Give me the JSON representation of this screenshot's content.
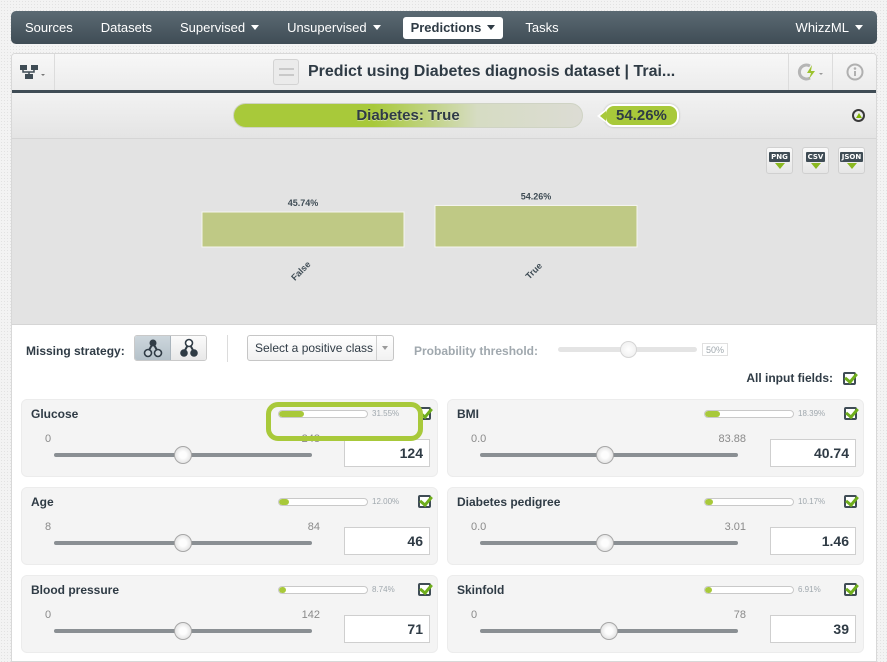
{
  "nav": {
    "items": [
      {
        "label": "Sources",
        "caret": false
      },
      {
        "label": "Datasets",
        "caret": false
      },
      {
        "label": "Supervised",
        "caret": true
      },
      {
        "label": "Unsupervised",
        "caret": true
      },
      {
        "label": "Predictions",
        "caret": true,
        "active": true
      },
      {
        "label": "Tasks",
        "caret": false
      }
    ],
    "right": {
      "label": "WhizzML"
    }
  },
  "toolbar": {
    "left_icon": "tree-structure-icon",
    "title": "Predict using Diabetes diagnosis dataset | Trai...",
    "title_icon": "model-sliders-icon",
    "right_icons": [
      "lightning-cycle-icon",
      "info-icon"
    ]
  },
  "prediction": {
    "label": "Diabetes: True",
    "confidence": "54.26%",
    "colors": {
      "accent": "#a8c93a",
      "dark": "#3f4c55"
    }
  },
  "exports": [
    {
      "label": "PNG"
    },
    {
      "label": "CSV"
    },
    {
      "label": "JSON"
    }
  ],
  "chart_data": {
    "type": "bar",
    "categories": [
      "False",
      "True"
    ],
    "values": [
      45.74,
      54.26
    ],
    "value_labels": [
      "45.74%",
      "54.26%"
    ],
    "title": "",
    "xlabel": "",
    "ylabel": "",
    "ylim": [
      0,
      100
    ],
    "grid": false,
    "bar_color": "#bfc985"
  },
  "controls": {
    "missing_strategy_label": "Missing strategy:",
    "positive_class_placeholder": "Select a positive class",
    "probability_threshold_label": "Probability threshold:",
    "probability_threshold_value": "50%",
    "probability_threshold_fraction": 0.5,
    "all_input_fields_label": "All input fields:"
  },
  "fields": [
    {
      "name": "Glucose",
      "importance": "31.55%",
      "importance_frac": 0.3155,
      "min": "0",
      "max": "248",
      "min_v": 0,
      "max_v": 248,
      "value": "124",
      "value_v": 124,
      "highlighted": true
    },
    {
      "name": "BMI",
      "importance": "18.39%",
      "importance_frac": 0.1839,
      "min": "0.0",
      "max": "83.88",
      "min_v": 0,
      "max_v": 83.88,
      "value": "40.74",
      "value_v": 40.74
    },
    {
      "name": "Age",
      "importance": "12.00%",
      "importance_frac": 0.12,
      "min": "8",
      "max": "84",
      "min_v": 8,
      "max_v": 84,
      "value": "46",
      "value_v": 46
    },
    {
      "name": "Diabetes pedigree",
      "importance": "10.17%",
      "importance_frac": 0.1017,
      "min": "0.0",
      "max": "3.01",
      "min_v": 0,
      "max_v": 3.01,
      "value": "1.46",
      "value_v": 1.46
    },
    {
      "name": "Blood pressure",
      "importance": "8.74%",
      "importance_frac": 0.0874,
      "min": "0",
      "max": "142",
      "min_v": 0,
      "max_v": 142,
      "value": "71",
      "value_v": 71
    },
    {
      "name": "Skinfold",
      "importance": "6.91%",
      "importance_frac": 0.0691,
      "min": "0",
      "max": "78",
      "min_v": 0,
      "max_v": 78,
      "value": "39",
      "value_v": 39
    }
  ]
}
